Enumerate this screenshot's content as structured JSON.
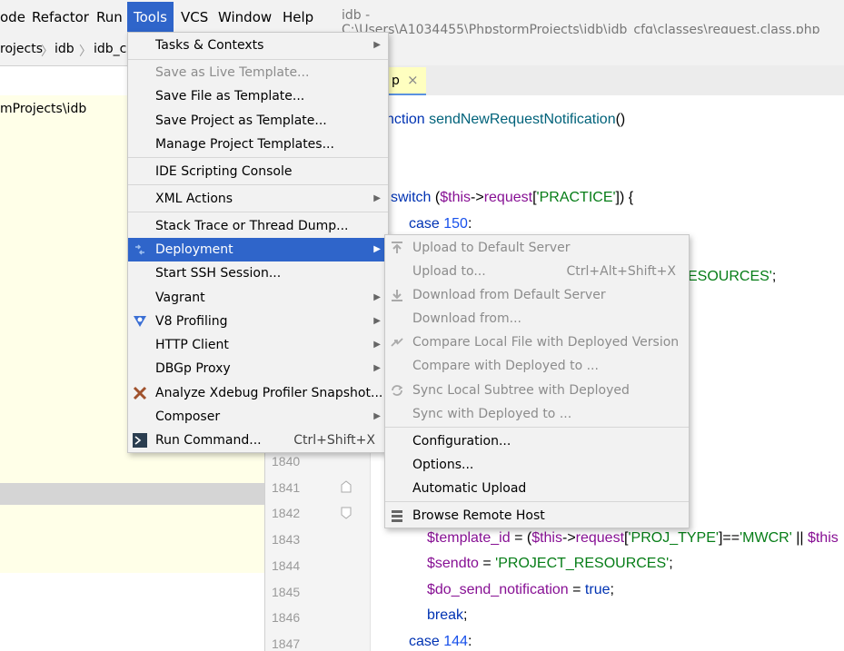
{
  "menubar": {
    "items": [
      "ode",
      "Refactor",
      "Run",
      "Tools",
      "VCS",
      "Window",
      "Help"
    ],
    "title": "idb - C:\\Users\\A1034455\\PhpstormProjects\\idb\\idb_cfg\\classes\\request.class.php"
  },
  "navbar": {
    "crumbs": [
      "rojects",
      "idb",
      "idb_c"
    ]
  },
  "tab": {
    "label": "p",
    "close": "×"
  },
  "project_panel": {
    "path": "mProjects\\idb"
  },
  "editor": {
    "line_numbers": [
      "1840",
      "1841",
      "1842",
      "1843",
      "1844",
      "1845",
      "1846",
      "1847"
    ],
    "lines": {
      "l1": [
        "nction ",
        "sendNewRequestNotification",
        "()"
      ],
      "l2": [
        "switch",
        " (",
        "$this",
        "->",
        "request",
        "[",
        "'PRACTICE'",
        "]) {"
      ],
      "l3": [
        "case ",
        "150",
        ":"
      ],
      "l4": [
        "ESOURCES'",
        ";"
      ],
      "l5": [
        "$template_id",
        " = (",
        "$this",
        "->",
        "request",
        "[",
        "'PROJ_TYPE'",
        "]==",
        "'MWCR'",
        " || ",
        "$this"
      ],
      "l6": [
        "$sendto",
        " = ",
        "'PROJECT_RESOURCES'",
        ";"
      ],
      "l7": [
        "$do_send_notification",
        " = ",
        "true",
        ";"
      ],
      "l8": [
        "break",
        ";"
      ],
      "l9": [
        "case ",
        "144",
        ":"
      ]
    }
  },
  "tools_menu": {
    "items": [
      {
        "label": "Tasks & Contexts",
        "submenu": true
      },
      {
        "label": "Save as Live Template...",
        "disabled": true
      },
      {
        "label": "Save File as Template..."
      },
      {
        "label": "Save Project as Template..."
      },
      {
        "label": "Manage Project Templates..."
      },
      {
        "label": "IDE Scripting Console"
      },
      {
        "label": "XML Actions",
        "submenu": true
      },
      {
        "label": "Stack Trace or Thread Dump..."
      },
      {
        "label": "Deployment",
        "submenu": true,
        "selected": true,
        "icon": "deployment-icon"
      },
      {
        "label": "Start SSH Session..."
      },
      {
        "label": "Vagrant",
        "submenu": true
      },
      {
        "label": "V8 Profiling",
        "submenu": true,
        "icon": "v8-icon"
      },
      {
        "label": "HTTP Client",
        "submenu": true
      },
      {
        "label": "DBGp Proxy",
        "submenu": true
      },
      {
        "label": "Analyze Xdebug Profiler Snapshot...",
        "icon": "xdebug-icon"
      },
      {
        "label": "Composer",
        "submenu": true
      },
      {
        "label": "Run Command...",
        "shortcut": "Ctrl+Shift+X",
        "icon": "terminal-icon"
      }
    ]
  },
  "deployment_menu": {
    "items": [
      {
        "label": "Upload to Default Server",
        "disabled": true,
        "icon": "upload-icon"
      },
      {
        "label": "Upload to...",
        "disabled": true,
        "shortcut": "Ctrl+Alt+Shift+X"
      },
      {
        "label": "Download from Default Server",
        "disabled": true,
        "icon": "download-icon"
      },
      {
        "label": "Download from...",
        "disabled": true
      },
      {
        "label": "Compare Local File with Deployed Version",
        "disabled": true,
        "icon": "compare-icon"
      },
      {
        "label": "Compare with Deployed to ...",
        "disabled": true
      },
      {
        "label": "Sync Local Subtree with Deployed",
        "disabled": true,
        "icon": "sync-icon"
      },
      {
        "label": "Sync with Deployed to ...",
        "disabled": true
      },
      {
        "label": "Configuration..."
      },
      {
        "label": "Options..."
      },
      {
        "label": "Automatic Upload"
      },
      {
        "label": "Browse Remote Host",
        "icon": "remote-host-icon"
      }
    ]
  },
  "colors": {
    "selection": "#2f65ca",
    "menu_bg": "#f2f2f2",
    "project_bg": "#ffffe8"
  }
}
